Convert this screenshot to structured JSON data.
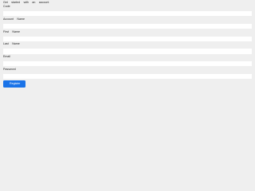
{
  "form": {
    "heading": "Get started with an account",
    "fields": [
      {
        "label": "Code",
        "value": "",
        "placeholder": ""
      },
      {
        "label": "Account Name",
        "value": "",
        "placeholder": ""
      },
      {
        "label": "First Name",
        "value": "",
        "placeholder": ""
      },
      {
        "label": "Last Name",
        "value": "",
        "placeholder": ""
      },
      {
        "label": "Email",
        "value": "",
        "placeholder": ""
      },
      {
        "label": "Password",
        "value": "",
        "placeholder": ""
      }
    ],
    "submit_label": "Register"
  },
  "colors": {
    "background": "#efefef",
    "input_background": "#ffffff",
    "accent": "#1a73e8"
  }
}
